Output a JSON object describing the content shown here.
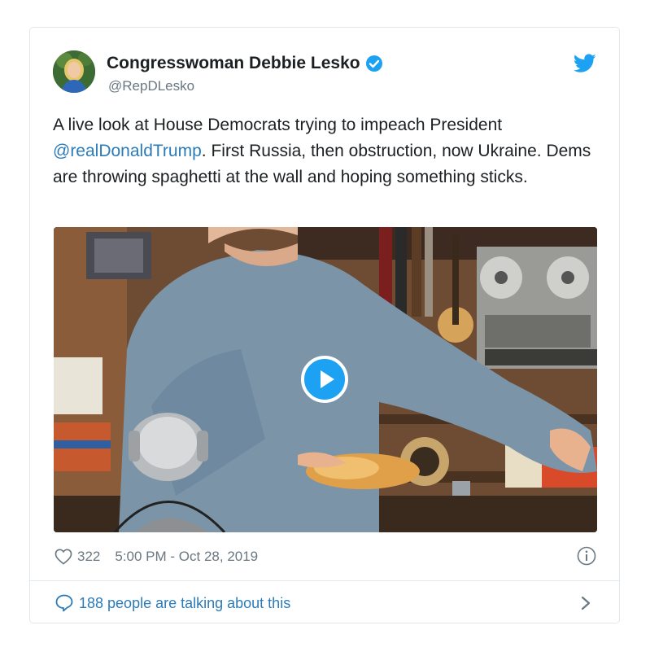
{
  "tweet": {
    "author_name": "Congresswoman Debbie Lesko",
    "author_handle": "@RepDLesko",
    "text_before": "A live look at House Democrats trying to impeach President ",
    "mention": "@realDonaldTrump",
    "text_after": ". First Russia, then obstruction, now Ukraine. Dems are throwing spaghetti at the wall and hoping something sticks.",
    "likes": "322",
    "timestamp": "5:00 PM - Oct 28, 2019",
    "conversation_text": "188 people are talking about this"
  },
  "icons": {
    "verified": "verified-badge-icon",
    "brand": "twitter-bird-icon",
    "like": "heart-icon",
    "info": "info-icon",
    "reply": "speech-bubble-icon",
    "next": "chevron-right-icon",
    "play": "play-icon"
  },
  "colors": {
    "accent": "#1da1f2",
    "link": "#2b7bb9",
    "muted": "#697882",
    "border": "#e1e8ed"
  }
}
